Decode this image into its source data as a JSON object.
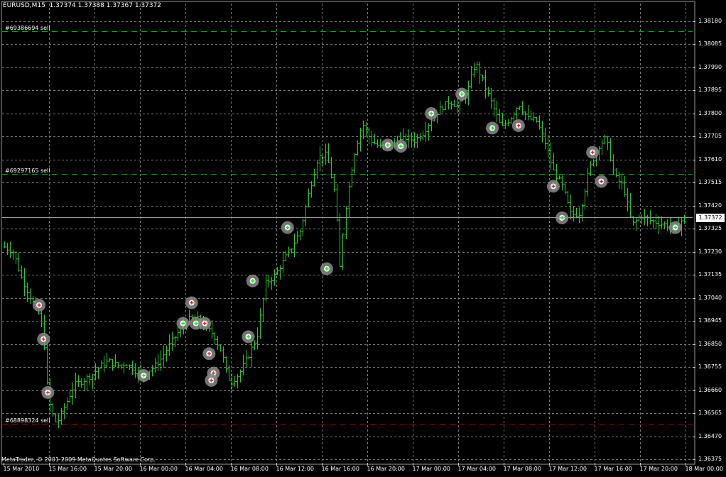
{
  "chart_header": {
    "symbol": "EURUSD,M15",
    "ohlc": "1.37374 1.37388 1.37367 1.37372"
  },
  "orders": [
    {
      "label": "#69386694 sell",
      "price": 1.3814,
      "color": "#00b000"
    },
    {
      "label": "#69297165 sell",
      "price": 1.37552,
      "color": "#00b000"
    },
    {
      "label": "#68898324 sell",
      "price": 1.3652,
      "color": "#c00000"
    }
  ],
  "copyright": "MetaTrader, © 2001-2009 MetaQuotes Software Corp.",
  "current_price": "1.37372",
  "colors": {
    "background": "#000000",
    "grid": "#7a7a7a",
    "candle": "#22cc22",
    "sell_line": "#00b000",
    "stop_line": "#c00000",
    "marker_ring": "#8a8a8a",
    "marker_buy": "#00ff00",
    "marker_sell": "#ff2020"
  },
  "chart_data": {
    "type": "bar",
    "y_ticks": [
      "1.38180",
      "1.38085",
      "1.37990",
      "1.37895",
      "1.37800",
      "1.37705",
      "1.37610",
      "1.37515",
      "1.37420",
      "1.37325",
      "1.37230",
      "1.37135",
      "1.37040",
      "1.36945",
      "1.36850",
      "1.36755",
      "1.36660",
      "1.36565",
      "1.36470",
      "1.36375"
    ],
    "y_tick_values": [
      1.3818,
      1.38085,
      1.3799,
      1.37895,
      1.378,
      1.37705,
      1.3761,
      1.37515,
      1.3742,
      1.37325,
      1.3723,
      1.37135,
      1.3704,
      1.36945,
      1.3685,
      1.36755,
      1.3666,
      1.36565,
      1.3647,
      1.36375
    ],
    "ylim": [
      1.36375,
      1.3818
    ],
    "x_ticks": [
      "15 Mar 2010",
      "15 Mar 16:00",
      "15 Mar 20:00",
      "16 Mar 00:00",
      "16 Mar 04:00",
      "16 Mar 08:00",
      "16 Mar 12:00",
      "16 Mar 16:00",
      "16 Mar 20:00",
      "17 Mar 00:00",
      "17 Mar 04:00",
      "17 Mar 08:00",
      "17 Mar 12:00",
      "17 Mar 16:00",
      "17 Mar 20:00",
      "18 Mar 00:00"
    ],
    "price_path": [
      [
        0,
        1.3725
      ],
      [
        2,
        1.3723
      ],
      [
        4,
        1.3712
      ],
      [
        6,
        1.3704
      ],
      [
        8,
        1.3697
      ],
      [
        9,
        1.3688
      ],
      [
        10,
        1.3663
      ],
      [
        11,
        1.3656
      ],
      [
        12,
        1.3652
      ],
      [
        14,
        1.366
      ],
      [
        16,
        1.3668
      ],
      [
        18,
        1.367
      ],
      [
        20,
        1.3672
      ],
      [
        22,
        1.3676
      ],
      [
        24,
        1.3678
      ],
      [
        26,
        1.3676
      ],
      [
        28,
        1.3677
      ],
      [
        30,
        1.3674
      ],
      [
        32,
        1.3673
      ],
      [
        34,
        1.3675
      ],
      [
        36,
        1.3679
      ],
      [
        38,
        1.3685
      ],
      [
        40,
        1.369
      ],
      [
        42,
        1.3695
      ],
      [
        44,
        1.3696
      ],
      [
        46,
        1.3692
      ],
      [
        48,
        1.3689
      ],
      [
        50,
        1.3681
      ],
      [
        51,
        1.3673
      ],
      [
        52,
        1.3669
      ],
      [
        54,
        1.3673
      ],
      [
        56,
        1.368
      ],
      [
        58,
        1.3688
      ],
      [
        60,
        1.371
      ],
      [
        62,
        1.3713
      ],
      [
        64,
        1.3719
      ],
      [
        66,
        1.3725
      ],
      [
        68,
        1.3732
      ],
      [
        70,
        1.3748
      ],
      [
        72,
        1.3762
      ],
      [
        74,
        1.3763
      ],
      [
        76,
        1.3746
      ],
      [
        77,
        1.3716
      ],
      [
        78,
        1.3738
      ],
      [
        80,
        1.3762
      ],
      [
        82,
        1.3776
      ],
      [
        84,
        1.3769
      ],
      [
        86,
        1.3766
      ],
      [
        88,
        1.3767
      ],
      [
        90,
        1.3768
      ],
      [
        92,
        1.377
      ],
      [
        94,
        1.3769
      ],
      [
        96,
        1.3772
      ],
      [
        98,
        1.3778
      ],
      [
        100,
        1.3782
      ],
      [
        102,
        1.3785
      ],
      [
        104,
        1.3783
      ],
      [
        106,
        1.3788
      ],
      [
        108,
        1.3801
      ],
      [
        110,
        1.3792
      ],
      [
        112,
        1.3783
      ],
      [
        114,
        1.3774
      ],
      [
        116,
        1.3778
      ],
      [
        118,
        1.3784
      ],
      [
        120,
        1.3778
      ],
      [
        122,
        1.3777
      ],
      [
        124,
        1.3768
      ],
      [
        126,
        1.3756
      ],
      [
        128,
        1.375
      ],
      [
        130,
        1.3738
      ],
      [
        132,
        1.3739
      ],
      [
        134,
        1.3756
      ],
      [
        136,
        1.3766
      ],
      [
        138,
        1.377
      ],
      [
        140,
        1.3754
      ],
      [
        142,
        1.375
      ],
      [
        144,
        1.3734
      ],
      [
        146,
        1.3738
      ],
      [
        148,
        1.3736
      ],
      [
        150,
        1.3735
      ],
      [
        152,
        1.3734
      ],
      [
        154,
        1.3733
      ],
      [
        156,
        1.37372
      ]
    ],
    "path_steps": 156,
    "markers": [
      {
        "step": 8,
        "price": 1.3701,
        "kind": "sell"
      },
      {
        "step": 9,
        "price": 1.3687,
        "kind": "sell"
      },
      {
        "step": 10,
        "price": 1.3665,
        "kind": "sell"
      },
      {
        "step": 32,
        "price": 1.3672,
        "kind": "buy"
      },
      {
        "step": 41,
        "price": 1.36935,
        "kind": "buy"
      },
      {
        "step": 43,
        "price": 1.3702,
        "kind": "sell"
      },
      {
        "step": 44,
        "price": 1.36935,
        "kind": "buy"
      },
      {
        "step": 46,
        "price": 1.36935,
        "kind": "sell"
      },
      {
        "step": 47,
        "price": 1.3681,
        "kind": "sell"
      },
      {
        "step": 48,
        "price": 1.3673,
        "kind": "sell"
      },
      {
        "step": 47.5,
        "price": 1.367,
        "kind": "sell"
      },
      {
        "step": 56,
        "price": 1.3688,
        "kind": "buy"
      },
      {
        "step": 57,
        "price": 1.3711,
        "kind": "buy"
      },
      {
        "step": 65,
        "price": 1.3733,
        "kind": "buy"
      },
      {
        "step": 74,
        "price": 1.3716,
        "kind": "buy"
      },
      {
        "step": 88,
        "price": 1.3767,
        "kind": "buy"
      },
      {
        "step": 91,
        "price": 1.37665,
        "kind": "buy"
      },
      {
        "step": 98,
        "price": 1.378,
        "kind": "buy"
      },
      {
        "step": 105,
        "price": 1.3788,
        "kind": "buy"
      },
      {
        "step": 112,
        "price": 1.3774,
        "kind": "buy"
      },
      {
        "step": 118,
        "price": 1.3775,
        "kind": "sell"
      },
      {
        "step": 126,
        "price": 1.375,
        "kind": "sell"
      },
      {
        "step": 128,
        "price": 1.3737,
        "kind": "buy"
      },
      {
        "step": 135,
        "price": 1.3764,
        "kind": "sell"
      },
      {
        "step": 137,
        "price": 1.3752,
        "kind": "sell"
      },
      {
        "step": 154,
        "price": 1.3733,
        "kind": "buy"
      }
    ]
  }
}
